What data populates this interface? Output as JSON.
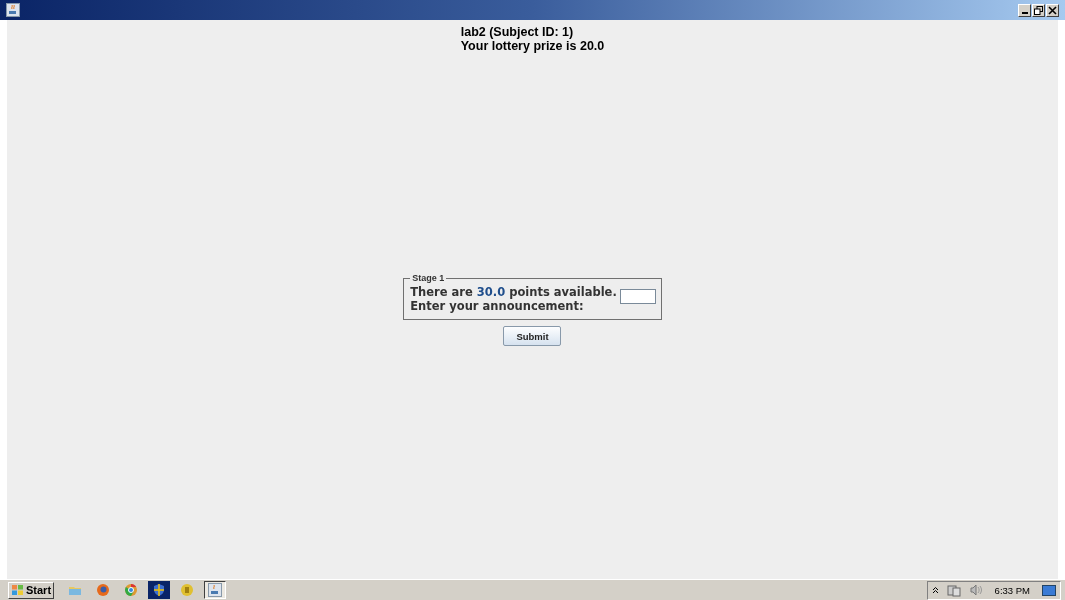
{
  "header": {
    "title": "lab2 (Subject ID: 1)",
    "prize": "Your lottery prize is 20.0"
  },
  "stage": {
    "legend": "Stage 1",
    "line1": {
      "before": "There are ",
      "value": "30.0",
      "after": " points available."
    },
    "line2": "Enter your announcement:"
  },
  "submit": "Submit",
  "taskbar": {
    "start": "Start",
    "apps": [
      {
        "kind": "folder",
        "selected": false
      },
      {
        "kind": "firefox",
        "selected": false
      },
      {
        "kind": "chrome",
        "selected": false
      },
      {
        "kind": "shield",
        "selected": false
      },
      {
        "kind": "coin",
        "selected": false
      },
      {
        "kind": "java",
        "selected": true
      }
    ],
    "clock": "6:33 PM"
  }
}
